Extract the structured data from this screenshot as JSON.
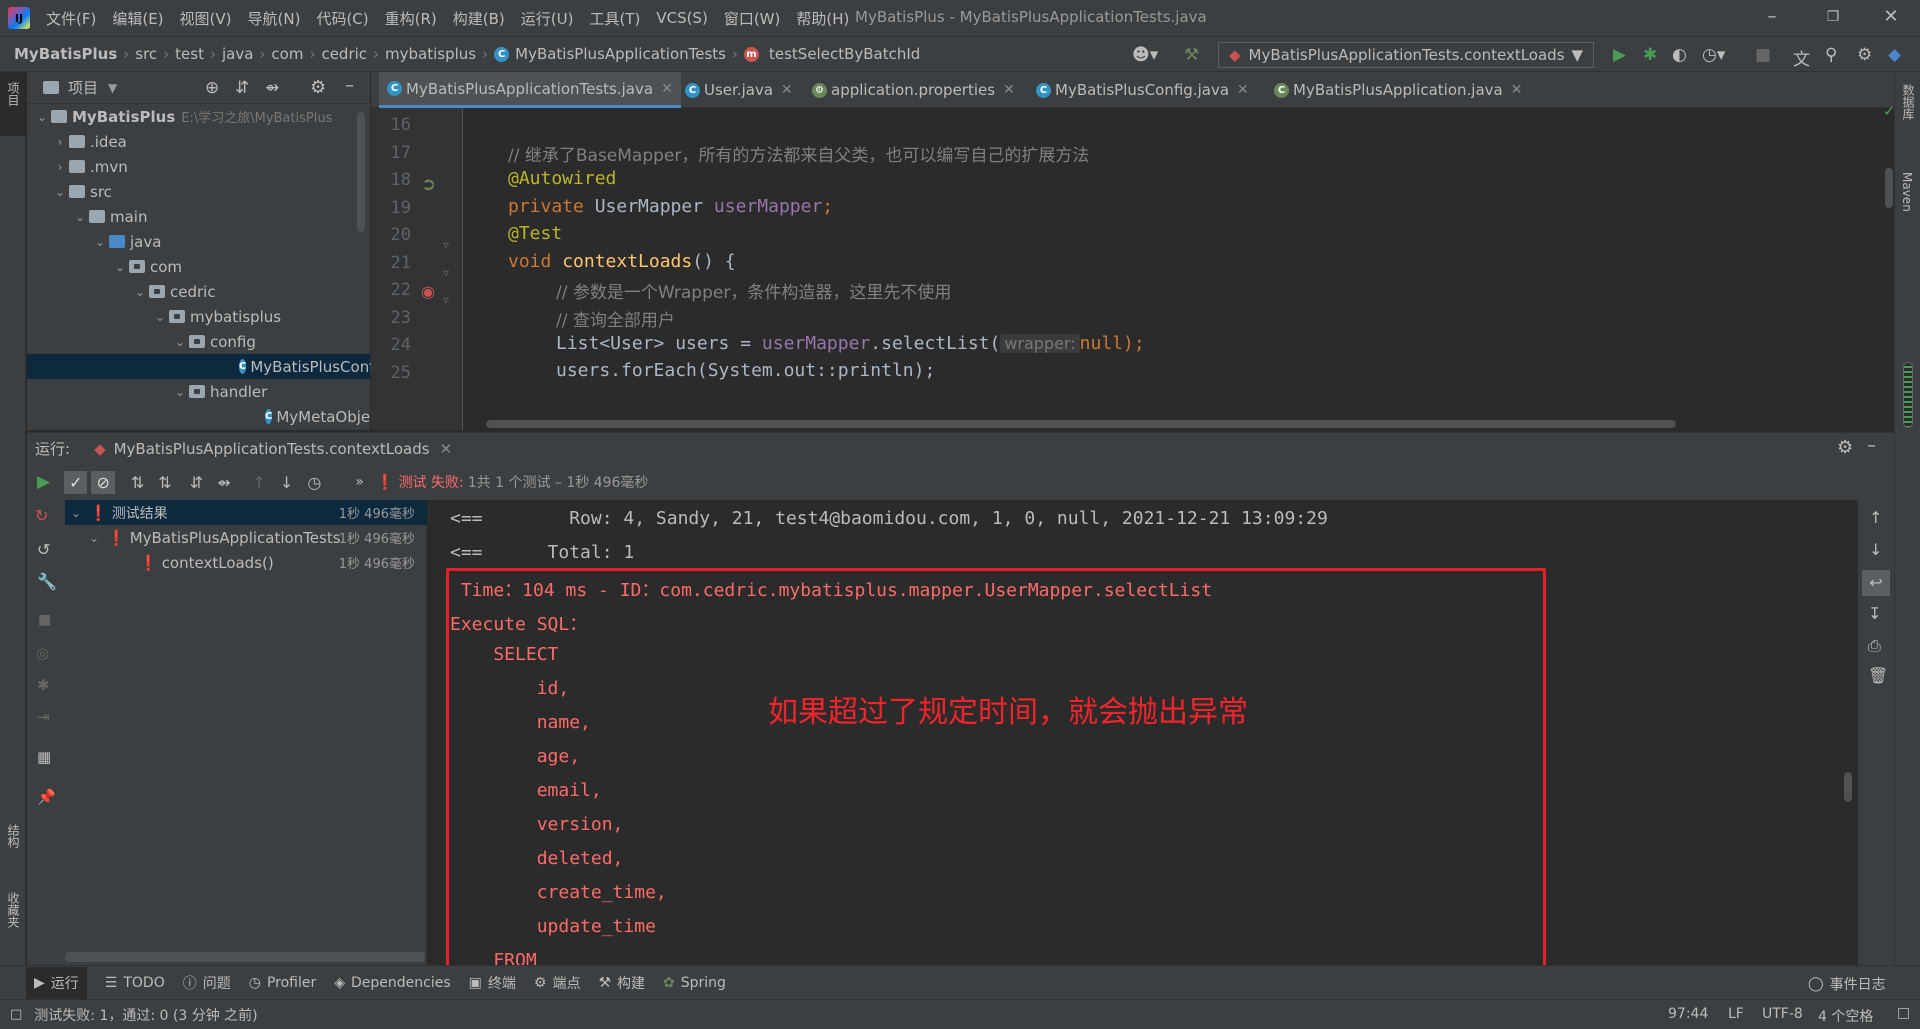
{
  "menubar": {
    "items": [
      "文件(F)",
      "编辑(E)",
      "视图(V)",
      "导航(N)",
      "代码(C)",
      "重构(R)",
      "构建(B)",
      "运行(U)",
      "工具(T)",
      "VCS(S)",
      "窗口(W)",
      "帮助(H)"
    ],
    "window_title": "MyBatisPlus - MyBatisPlusApplicationTests.java"
  },
  "navbar": {
    "crumbs": [
      "MyBatisPlus",
      "src",
      "test",
      "java",
      "com",
      "cedric",
      "mybatisplus",
      "MyBatisPlusApplicationTests",
      "testSelectByBatchId"
    ],
    "run_config": "MyBatisPlusApplicationTests.contextLoads"
  },
  "left_strip": {
    "project": "项目",
    "structure": "结构",
    "favorites": "收藏夹"
  },
  "right_strip": {
    "database": "数据库",
    "maven": "Maven"
  },
  "project": {
    "title": "项目",
    "root": "MyBatisPlus",
    "root_path": "E:\\学习之旅\\MyBatisPlus",
    "items": [
      ".idea",
      ".mvn",
      "src",
      "main",
      "java",
      "com",
      "cedric",
      "mybatisplus",
      "config",
      "MyBatisPlusConfig",
      "handler",
      "MyMetaObjectHandler"
    ]
  },
  "editor": {
    "tabs": [
      "MyBatisPlusApplicationTests.java",
      "User.java",
      "application.properties",
      "MyBatisPlusConfig.java",
      "MyBatisPlusApplication.java"
    ],
    "line_numbers": [
      "16",
      "17",
      "18",
      "19",
      "20",
      "21",
      "22",
      "23",
      "24",
      "25"
    ],
    "lines": {
      "l17": "// 继承了BaseMapper，所有的方法都来自父类，也可以编写自己的扩展方法",
      "l18": "@Autowired",
      "l19_kw": "private ",
      "l19_type": "UserMapper ",
      "l19_field": "userMapper",
      "l19_end": ";",
      "l20": "@Test",
      "l21_kw": "void ",
      "l21_method": "contextLoads",
      "l21_end": "() {",
      "l22": "// 参数是一个Wrapper，条件构造器，这里先不使用",
      "l23": "// 查询全部用户",
      "l24_start": "List<User> users = ",
      "l24_field": "userMapper",
      "l24_call": ".selectList(",
      "l24_hint": "wrapper:",
      "l24_null": "null",
      "l24_end": ");",
      "l25": "users.forEach(System.out::println);"
    }
  },
  "run": {
    "label": "运行:",
    "tab": "MyBatisPlusApplicationTests.contextLoads",
    "status_prefix": "测试 失败:",
    "status_detail": "1共 1 个测试 – 1秒 496毫秒",
    "tree": [
      {
        "label": "测试结果",
        "time": "1秒 496毫秒"
      },
      {
        "label": "MyBatisPlusApplicationTests",
        "time": "1秒 496毫秒"
      },
      {
        "label": "contextLoads()",
        "time": "1秒 496毫秒"
      }
    ]
  },
  "console": {
    "lines": [
      "<==        Row: 4, Sandy, 21, test4@baomidou.com, 1, 0, null, 2021-12-21 13:09:29",
      "<==      Total: 1",
      " Time：104 ms - ID：com.cedric.mybatisplus.mapper.UserMapper.selectList",
      "Execute SQL：",
      "    SELECT",
      "        id,",
      "        name,",
      "        age,",
      "        email,",
      "        version,",
      "        deleted,",
      "        create_time,",
      "        update_time",
      "    FROM"
    ],
    "annotation": "如果超过了规定时间，就会抛出异常"
  },
  "bottom_tabs": [
    "运行",
    "TODO",
    "问题",
    "Profiler",
    "Dependencies",
    "终端",
    "端点",
    "构建",
    "Spring"
  ],
  "event_log": "事件日志",
  "status": {
    "message": "测试失败: 1，通过: 0 (3 分钟 之前)",
    "position": "97:44",
    "line_sep": "LF",
    "encoding": "UTF-8",
    "indent": "4 个空格"
  },
  "colors": {
    "error": "#ff6b68",
    "highlight_box": "#e8202a",
    "accent": "#4a88c7"
  }
}
